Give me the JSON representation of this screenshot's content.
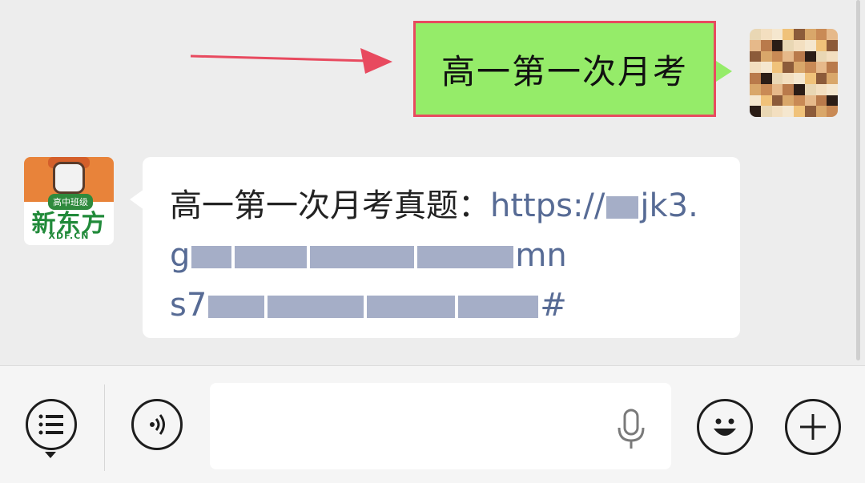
{
  "messages": [
    {
      "direction": "outgoing",
      "text": "高一第一次月考",
      "highlight_color": "#e84a5f"
    },
    {
      "direction": "incoming",
      "sender": "新东方",
      "prefix": "高一第一次月考真题：",
      "link_parts": [
        "https://",
        "jk3.",
        "g",
        "mn",
        "s7",
        "#"
      ]
    }
  ],
  "avatars": {
    "bot": {
      "tag": "高中班级",
      "brand": "新东方",
      "sub": "XDF.CN"
    }
  },
  "toolbar": {
    "menu_icon": "list-icon",
    "voice_icon": "voice-icon",
    "input_placeholder": "",
    "mic_icon": "mic-icon",
    "emoji_icon": "emoji-icon",
    "plus_icon": "plus-icon"
  },
  "colors": {
    "chat_bg": "#ededed",
    "outgoing_bubble": "#95ec69",
    "incoming_bubble": "#ffffff",
    "link": "#576b95",
    "brand_green": "#218a3a",
    "brand_orange": "#e8833a"
  }
}
